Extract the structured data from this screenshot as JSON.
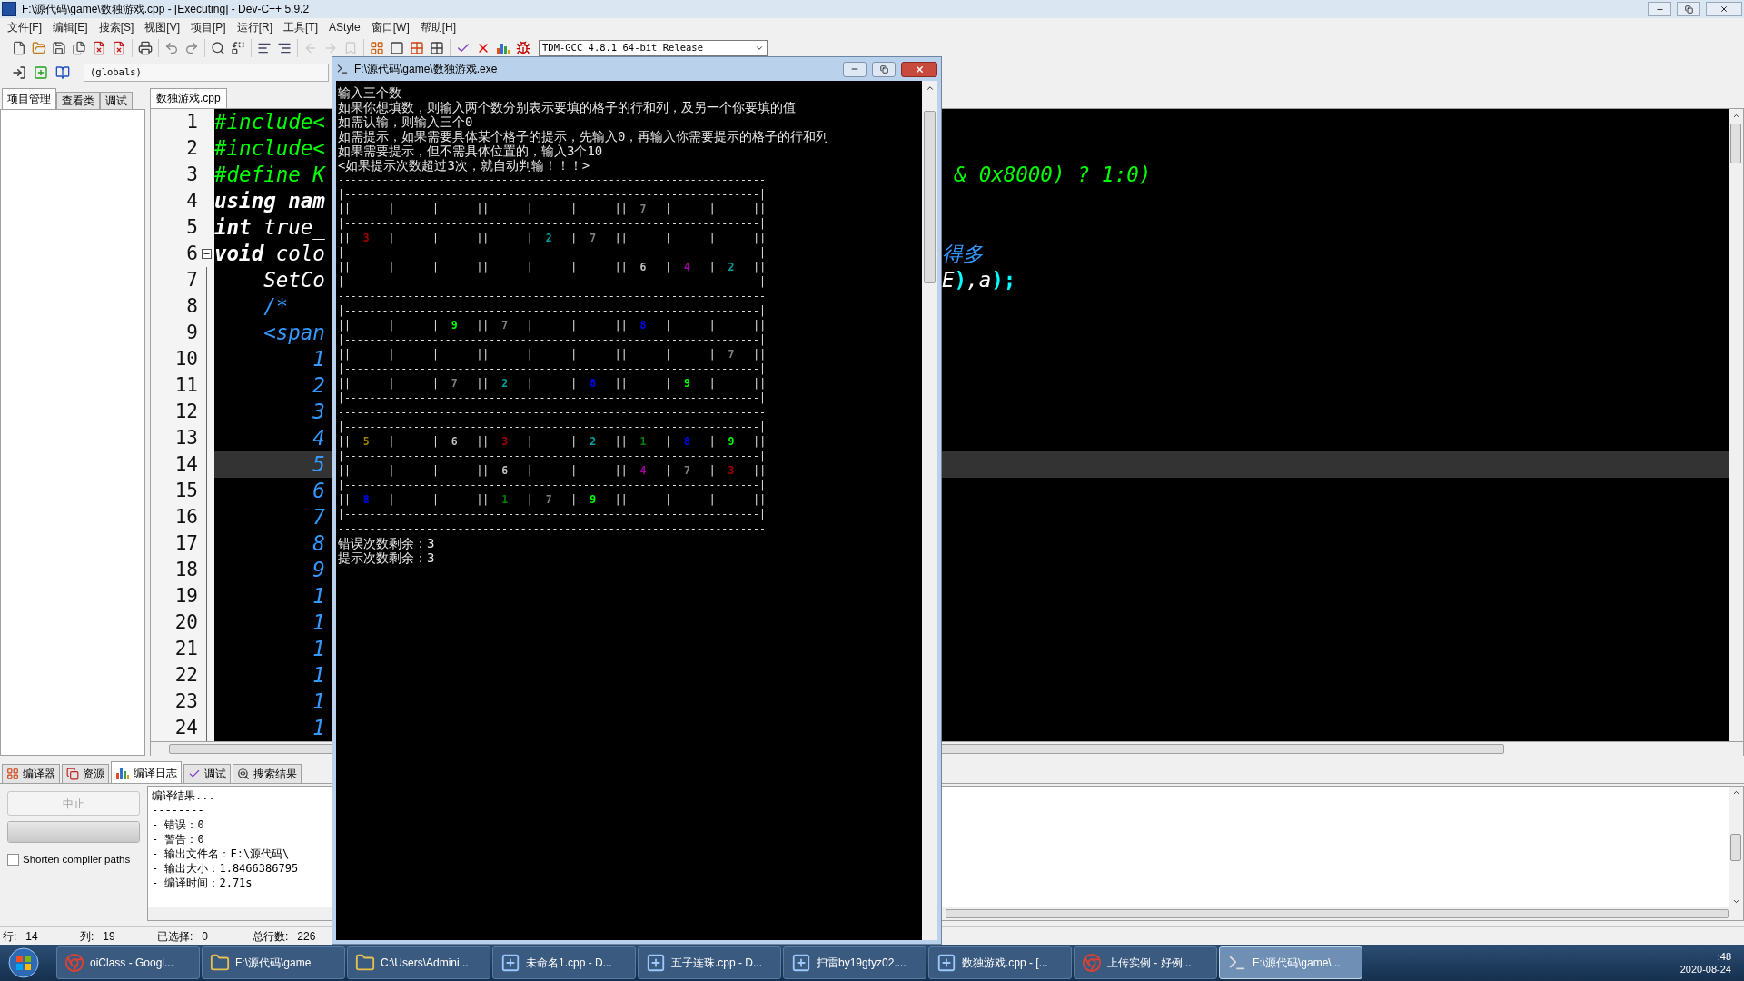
{
  "window": {
    "title": "F:\\源代码\\game\\数独游戏.cpp - [Executing] - Dev-C++ 5.9.2"
  },
  "menu": [
    "文件[F]",
    "编辑[E]",
    "搜索[S]",
    "视图[V]",
    "项目[P]",
    "运行[R]",
    "工具[T]",
    "AStyle",
    "窗口[W]",
    "帮助[H]"
  ],
  "compiler_select": {
    "value": "TDM-GCC 4.8.1 64-bit Release"
  },
  "scope_select": {
    "value": "(globals)"
  },
  "left_tabs": [
    {
      "label": "项目管理",
      "selected": true
    },
    {
      "label": "查看类",
      "selected": false
    },
    {
      "label": "调试",
      "selected": false
    }
  ],
  "editor": {
    "tabs": [
      {
        "label": "数独游戏.cpp",
        "selected": true
      }
    ],
    "lines": [
      {
        "number": "1",
        "current": false,
        "left": [
          {
            "text": "#include<",
            "kind": "preprocessor"
          }
        ]
      },
      {
        "number": "2",
        "current": false,
        "left": [
          {
            "text": "#include<",
            "kind": "preprocessor"
          }
        ]
      },
      {
        "number": "3",
        "current": false,
        "left": [
          {
            "text": "#define K",
            "kind": "preprocessor"
          }
        ],
        "right": [
          {
            "text": " & 0x8000) ? 1:0)",
            "kind": "preprocessor"
          }
        ]
      },
      {
        "number": "4",
        "current": false,
        "left": [
          {
            "text": "using nam",
            "kind": "keyword"
          }
        ]
      },
      {
        "number": "5",
        "current": false,
        "left": [
          {
            "text": "int",
            "kind": "keyword"
          },
          {
            "text": " true_",
            "kind": "identifier"
          }
        ]
      },
      {
        "number": "6",
        "current": false,
        "fold": {
          "expanded": true
        },
        "left": [
          {
            "text": "void",
            "kind": "keyword"
          },
          {
            "text": " colo",
            "kind": "identifier"
          }
        ],
        "right": [
          {
            "text": "得多",
            "kind": "comment"
          }
        ]
      },
      {
        "number": "7",
        "current": false,
        "left": [
          {
            "text": "    SetCo",
            "kind": "identifier"
          }
        ],
        "right": [
          {
            "text": "E",
            "kind": "identifier"
          },
          {
            "text": ")",
            "kind": "symbol"
          },
          {
            "text": ",a",
            "kind": "identifier"
          },
          {
            "text": ");",
            "kind": "symbol"
          }
        ]
      },
      {
        "number": "8",
        "current": false,
        "left": [
          {
            "text": "    /*",
            "kind": "comment"
          }
        ]
      },
      {
        "number": "9",
        "current": false,
        "left": [
          {
            "text": "    <span",
            "kind": "comment"
          }
        ]
      },
      {
        "number": "10",
        "current": false,
        "left": [
          {
            "text": "        1",
            "kind": "comment"
          }
        ]
      },
      {
        "number": "11",
        "current": false,
        "left": [
          {
            "text": "        2",
            "kind": "comment"
          }
        ]
      },
      {
        "number": "12",
        "current": false,
        "left": [
          {
            "text": "        3",
            "kind": "comment"
          }
        ]
      },
      {
        "number": "13",
        "current": false,
        "left": [
          {
            "text": "        4",
            "kind": "comment"
          }
        ]
      },
      {
        "number": "14",
        "current": true,
        "left": [
          {
            "text": "        5",
            "kind": "comment"
          }
        ]
      },
      {
        "number": "15",
        "current": false,
        "left": [
          {
            "text": "        6",
            "kind": "comment"
          }
        ]
      },
      {
        "number": "16",
        "current": false,
        "left": [
          {
            "text": "        7",
            "kind": "comment"
          }
        ]
      },
      {
        "number": "17",
        "current": false,
        "left": [
          {
            "text": "        8",
            "kind": "comment"
          }
        ]
      },
      {
        "number": "18",
        "current": false,
        "left": [
          {
            "text": "        9",
            "kind": "comment"
          }
        ]
      },
      {
        "number": "19",
        "current": false,
        "left": [
          {
            "text": "        1",
            "kind": "comment"
          }
        ]
      },
      {
        "number": "20",
        "current": false,
        "left": [
          {
            "text": "        1",
            "kind": "comment"
          }
        ]
      },
      {
        "number": "21",
        "current": false,
        "left": [
          {
            "text": "        1",
            "kind": "comment"
          }
        ]
      },
      {
        "number": "22",
        "current": false,
        "left": [
          {
            "text": "        1",
            "kind": "comment"
          }
        ]
      },
      {
        "number": "23",
        "current": false,
        "left": [
          {
            "text": "        1",
            "kind": "comment"
          }
        ]
      },
      {
        "number": "24",
        "current": false,
        "left": [
          {
            "text": "        1",
            "kind": "comment"
          }
        ]
      }
    ]
  },
  "bottom_tabs": [
    {
      "label": "编译器",
      "selected": false
    },
    {
      "label": "资源",
      "selected": false
    },
    {
      "label": "编译日志",
      "selected": true
    },
    {
      "label": "调试",
      "selected": false
    },
    {
      "label": "搜索结果",
      "selected": false
    }
  ],
  "progress": {
    "level": 1
  },
  "abort_button": {
    "label": "中止",
    "disabled": true
  },
  "shorten_paths": {
    "label": "Shorten compiler paths",
    "checked": false
  },
  "compile_log": [
    "编译结果...",
    "--------",
    "- 错误：0",
    "- 警告：0",
    "- 输出文件名：F:\\源代码\\",
    "- 输出大小：1.8466386795",
    "- 编译时间：2.71s"
  ],
  "status_bar": [
    {
      "label": "行:",
      "value": "14"
    },
    {
      "label": "列:",
      "value": "19"
    },
    {
      "label": "已选择:",
      "value": "0"
    },
    {
      "label": "总行数:",
      "value": "226"
    }
  ],
  "console": {
    "title": "F:\\源代码\\game\\数独游戏.exe",
    "block_bar": "||",
    "cell_bar": "|",
    "lines": [
      {
        "kind": "text",
        "text": "输入三个数"
      },
      {
        "kind": "text",
        "text": "如果你想填数，则输入两个数分别表示要填的格子的行和列，及另一个你要填的值"
      },
      {
        "kind": "text",
        "text": "如需认输，则输入三个0"
      },
      {
        "kind": "text",
        "text": "如需提示，如果需要具体某个格子的提示，先输入0，再输入你需要提示的格子的行和列"
      },
      {
        "kind": "text",
        "text": "如果需要提示，但不需具体位置的，输入3个10"
      },
      {
        "kind": "text",
        "text": "<如果提示次数超过3次，就自动判输！！！>"
      },
      {
        "kind": "rule",
        "text": "--------------------------------------------------------------------"
      },
      {
        "kind": "rule",
        "text": "|------------------------------------------------------------------|"
      },
      {
        "kind": "row",
        "cells": [
          null,
          null,
          null,
          null,
          null,
          null,
          {
            "digit": "7",
            "color": "#808080"
          },
          null,
          null
        ]
      },
      {
        "kind": "rule",
        "text": "|------------------------------------------------------------------|"
      },
      {
        "kind": "row",
        "cells": [
          {
            "digit": "3",
            "color": "#a00000"
          },
          null,
          null,
          null,
          {
            "digit": "2",
            "color": "#00a0a0"
          },
          {
            "digit": "7",
            "color": "#808080"
          },
          null,
          null,
          null
        ]
      },
      {
        "kind": "rule",
        "text": "|------------------------------------------------------------------|"
      },
      {
        "kind": "row",
        "cells": [
          null,
          null,
          null,
          null,
          null,
          null,
          {
            "digit": "6",
            "color": "#c0c0c0"
          },
          {
            "digit": "4",
            "color": "#a000a0"
          },
          {
            "digit": "2",
            "color": "#00a0a0"
          }
        ]
      },
      {
        "kind": "rule",
        "text": "|------------------------------------------------------------------|"
      },
      {
        "kind": "rule",
        "text": "--------------------------------------------------------------------"
      },
      {
        "kind": "rule",
        "text": "|------------------------------------------------------------------|"
      },
      {
        "kind": "row",
        "cells": [
          null,
          null,
          {
            "digit": "9",
            "color": "#00ff00"
          },
          {
            "digit": "7",
            "color": "#808080"
          },
          null,
          null,
          {
            "digit": "8",
            "color": "#0000ff"
          },
          null,
          null
        ]
      },
      {
        "kind": "rule",
        "text": "|------------------------------------------------------------------|"
      },
      {
        "kind": "row",
        "cells": [
          null,
          null,
          null,
          null,
          null,
          null,
          null,
          null,
          {
            "digit": "7",
            "color": "#808080"
          }
        ]
      },
      {
        "kind": "rule",
        "text": "|------------------------------------------------------------------|"
      },
      {
        "kind": "row",
        "cells": [
          null,
          null,
          {
            "digit": "7",
            "color": "#808080"
          },
          {
            "digit": "2",
            "color": "#00a0a0"
          },
          null,
          {
            "digit": "8",
            "color": "#0000ff"
          },
          null,
          {
            "digit": "9",
            "color": "#00ff00"
          },
          null
        ]
      },
      {
        "kind": "rule",
        "text": "|------------------------------------------------------------------|"
      },
      {
        "kind": "rule",
        "text": "--------------------------------------------------------------------"
      },
      {
        "kind": "rule",
        "text": "|------------------------------------------------------------------|"
      },
      {
        "kind": "row",
        "cells": [
          {
            "digit": "5",
            "color": "#a08000"
          },
          null,
          {
            "digit": "6",
            "color": "#c0c0c0"
          },
          {
            "digit": "3",
            "color": "#a00000"
          },
          null,
          {
            "digit": "2",
            "color": "#00a0a0"
          },
          {
            "digit": "1",
            "color": "#008000"
          },
          {
            "digit": "8",
            "color": "#0000ff"
          },
          {
            "digit": "9",
            "color": "#00ff00"
          }
        ]
      },
      {
        "kind": "rule",
        "text": "|------------------------------------------------------------------|"
      },
      {
        "kind": "row",
        "cells": [
          null,
          null,
          null,
          {
            "digit": "6",
            "color": "#c0c0c0"
          },
          null,
          null,
          {
            "digit": "4",
            "color": "#a000a0"
          },
          {
            "digit": "7",
            "color": "#808080"
          },
          {
            "digit": "3",
            "color": "#a00000"
          }
        ]
      },
      {
        "kind": "rule",
        "text": "|------------------------------------------------------------------|"
      },
      {
        "kind": "row",
        "cells": [
          {
            "digit": "8",
            "color": "#0000ff"
          },
          null,
          null,
          {
            "digit": "1",
            "color": "#008000"
          },
          {
            "digit": "7",
            "color": "#808080"
          },
          {
            "digit": "9",
            "color": "#00ff00"
          },
          null,
          null,
          null
        ]
      },
      {
        "kind": "rule",
        "text": "|------------------------------------------------------------------|"
      },
      {
        "kind": "rule",
        "text": "--------------------------------------------------------------------"
      },
      {
        "kind": "text",
        "text": "错误次数剩余：3"
      },
      {
        "kind": "text",
        "text": "提示次数剩余：3"
      }
    ]
  },
  "taskbar": [
    {
      "label": "oiClass - Googl...",
      "kind": "browser",
      "selected": false
    },
    {
      "label": "F:\\源代码\\game",
      "kind": "folder",
      "selected": false
    },
    {
      "label": "C:\\Users\\Admini...",
      "kind": "folder",
      "selected": false
    },
    {
      "label": "未命名1.cpp - D...",
      "kind": "ide",
      "selected": false
    },
    {
      "label": "五子连珠.cpp - D...",
      "kind": "ide",
      "selected": false
    },
    {
      "label": "扫雷by19gtyz02....",
      "kind": "ide",
      "selected": false
    },
    {
      "label": "数独游戏.cpp - [...",
      "kind": "ide",
      "selected": false
    },
    {
      "label": "上传实例 - 好例...",
      "kind": "browser",
      "selected": false
    },
    {
      "label": "F:\\源代码\\game\\...",
      "kind": "console",
      "selected": true
    }
  ],
  "clock": {
    "time": ":48",
    "date": "2020-08-24"
  }
}
